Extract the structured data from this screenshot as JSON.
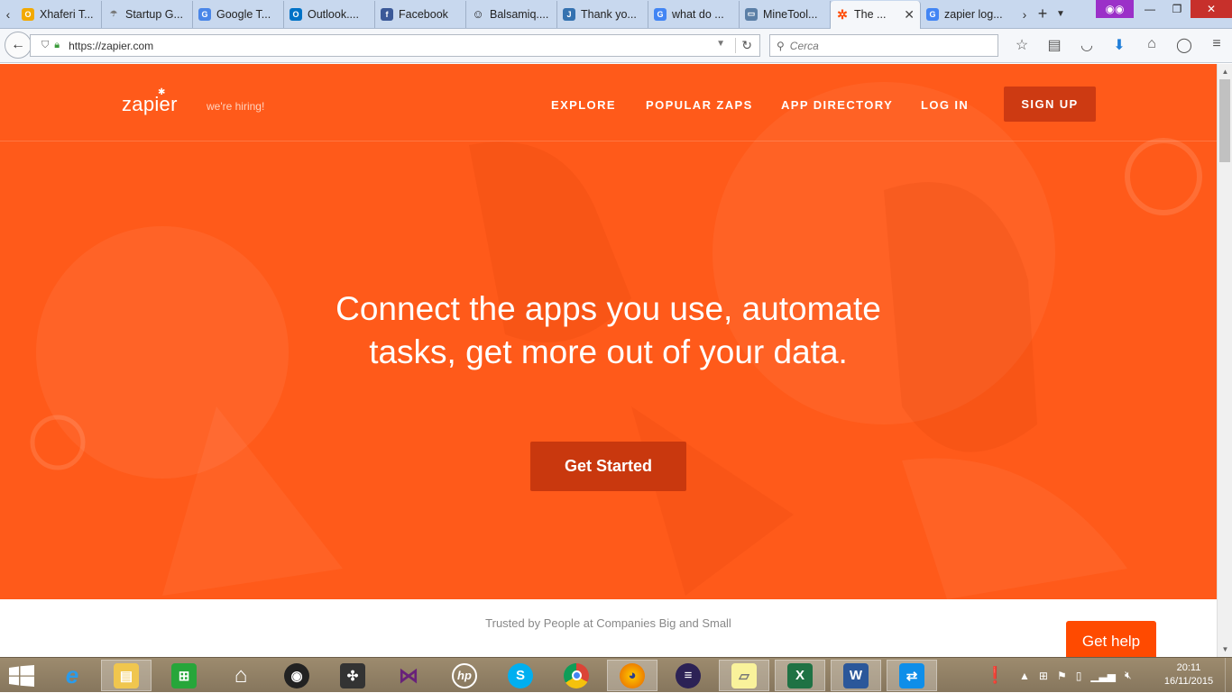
{
  "browser": {
    "tabs": [
      {
        "label": "Xhaferi T...",
        "icon": "outlook-o-icon",
        "color": "#f2a900"
      },
      {
        "label": "Startup G...",
        "icon": "umbrella-icon",
        "color": "#8a8a8a"
      },
      {
        "label": "Google T...",
        "icon": "google-translate-icon",
        "color": "#4a86e8"
      },
      {
        "label": "Outlook....",
        "icon": "outlook-icon",
        "color": "#0072c6"
      },
      {
        "label": "Facebook",
        "icon": "facebook-icon",
        "color": "#3b5998"
      },
      {
        "label": "Balsamiq....",
        "icon": "smiley-icon",
        "color": "#333333"
      },
      {
        "label": "Thank yo...",
        "icon": "jira-icon",
        "color": "#3572b0"
      },
      {
        "label": "what do ...",
        "icon": "google-icon",
        "color": "#4285f4"
      },
      {
        "label": "MineTool...",
        "icon": "page-icon",
        "color": "#5b7fa6"
      },
      {
        "label": "The ...",
        "icon": "zapier-icon",
        "color": "#ff4a00",
        "active": true
      },
      {
        "label": "zapier log...",
        "icon": "google-icon",
        "color": "#4285f4"
      }
    ],
    "url": "https://zapier.com",
    "search_placeholder": "Cerca"
  },
  "page": {
    "logo": "zapier",
    "hiring": "we're hiring!",
    "nav": [
      "EXPLORE",
      "POPULAR ZAPS",
      "APP DIRECTORY",
      "LOG IN"
    ],
    "signup": "SIGN UP",
    "headline_1": "Connect the apps you use, automate",
    "headline_2": "tasks, get more out of your data.",
    "cta": "Get Started",
    "trusted": "Trusted by People at Companies Big and Small",
    "help": "Get help"
  },
  "taskbar": {
    "apps": [
      "internet-explorer",
      "file-explorer",
      "store",
      "home",
      "camera",
      "puzzle",
      "visual-studio",
      "hp",
      "skype",
      "chrome",
      "firefox",
      "eclipse",
      "sticky-notes",
      "excel",
      "word",
      "teamviewer"
    ],
    "time": "20:11",
    "date": "16/11/2015"
  },
  "colors": {
    "hero": "#ff5a1a",
    "cta": "#c9380e",
    "signup": "#cd3a12",
    "help": "#ff4a00"
  }
}
